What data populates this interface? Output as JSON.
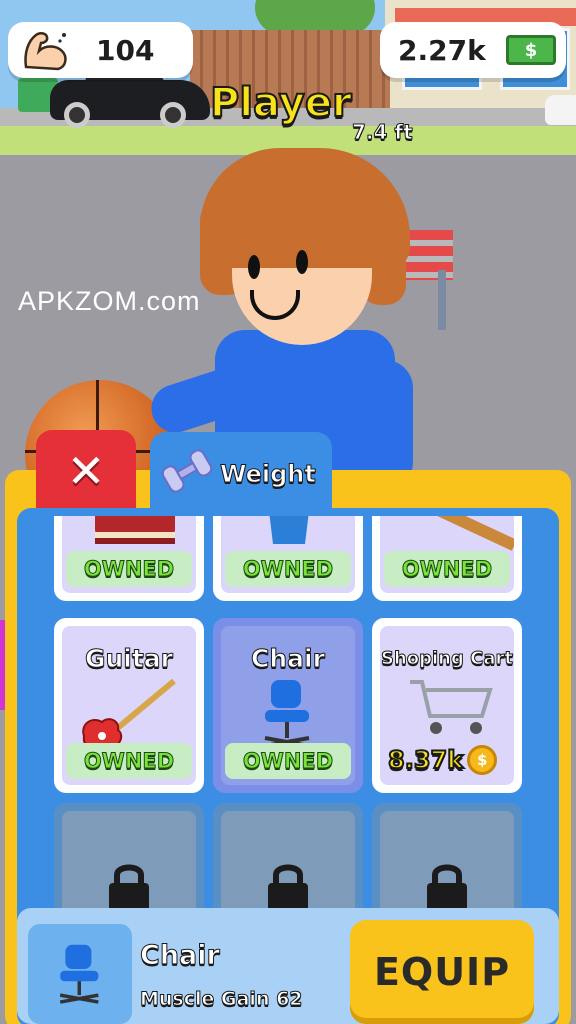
{
  "hud": {
    "muscle_value": "104",
    "money_value": "2.27k",
    "muscle_icon": "flexed-arm-icon",
    "money_icon": "cash-bill-icon",
    "money_symbol": "$"
  },
  "player": {
    "name": "Player",
    "height": "7.4 ft"
  },
  "watermark": "APKZOM.com",
  "shop": {
    "close_icon": "close-x-icon",
    "close_glyph": "✕",
    "tab_label": "Weight",
    "tab_icon": "dumbbell-icon",
    "items": [
      {
        "name": "",
        "status": "OWNED",
        "icon": "book-icon"
      },
      {
        "name": "",
        "status": "OWNED",
        "icon": "cup-icon"
      },
      {
        "name": "",
        "status": "OWNED",
        "icon": "plank-icon"
      },
      {
        "name": "Guitar",
        "status": "OWNED",
        "icon": "guitar-icon"
      },
      {
        "name": "Chair",
        "status": "OWNED",
        "icon": "chair-icon",
        "selected": true
      },
      {
        "name": "Shoping Cart",
        "price": "8.37k",
        "icon": "shopping-cart-icon"
      },
      {
        "locked": true,
        "icon": "lock-icon"
      },
      {
        "locked": true,
        "icon": "lock-icon"
      },
      {
        "locked": true,
        "icon": "lock-icon"
      }
    ],
    "coin_symbol": "$"
  },
  "selected_item": {
    "name": "Chair",
    "stat": "Muscle Gain 62"
  },
  "equip_label": "EQUIP",
  "colors": {
    "panel_yellow": "#f9c31b",
    "panel_blue": "#3b8ee3",
    "close_red": "#e5303a",
    "owned_green": "#7be23a"
  }
}
